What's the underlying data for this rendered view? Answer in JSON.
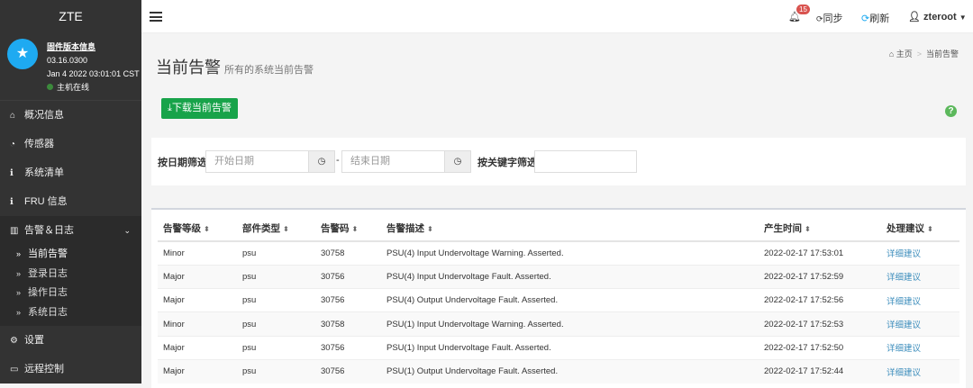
{
  "sidebar": {
    "brand": "ZTE",
    "firmware_title": "固件版本信息",
    "version": "03.16.0300",
    "build_date": "Jan 4 2022 03:01:01 CST",
    "host_status": "主机在线",
    "items": [
      {
        "label": "概况信息",
        "icon": "home-icon"
      },
      {
        "label": "传感器",
        "icon": "dashboard-icon"
      },
      {
        "label": "系统清单",
        "icon": "info-icon"
      },
      {
        "label": "FRU 信息",
        "icon": "info-icon"
      },
      {
        "label": "告警＆日志",
        "icon": "chart-icon"
      }
    ],
    "sub_items": [
      {
        "label": "当前告警"
      },
      {
        "label": "登录日志"
      },
      {
        "label": "操作日志"
      },
      {
        "label": "系统日志"
      }
    ],
    "bottom_items": [
      {
        "label": "设置",
        "icon": "gear-icon"
      },
      {
        "label": "远程控制",
        "icon": "monitor-icon"
      }
    ]
  },
  "topbar": {
    "notification_count": "15",
    "sync": "同步",
    "refresh": "刷新",
    "user": "zteroot"
  },
  "page": {
    "title": "当前告警",
    "subtitle": "所有的系统当前告警",
    "breadcrumb_home": "主页",
    "breadcrumb_current": "当前告警",
    "download_button": "下载当前告警"
  },
  "filter": {
    "date_label": "按日期筛选",
    "start_placeholder": "开始日期",
    "dash": "-",
    "end_placeholder": "结束日期",
    "keyword_label": "按关键字筛选"
  },
  "table": {
    "headers": [
      "告警等级",
      "部件类型",
      "告警码",
      "告警描述",
      "产生时间",
      "处理建议"
    ],
    "rows": [
      [
        "Minor",
        "psu",
        "30758",
        "PSU(4) Input Undervoltage Warning. Asserted.",
        "2022-02-17 17:53:01",
        "详细建议"
      ],
      [
        "Major",
        "psu",
        "30756",
        "PSU(4) Input Undervoltage Fault. Asserted.",
        "2022-02-17 17:52:59",
        "详细建议"
      ],
      [
        "Major",
        "psu",
        "30756",
        "PSU(4) Output Undervoltage Fault. Asserted.",
        "2022-02-17 17:52:56",
        "详细建议"
      ],
      [
        "Minor",
        "psu",
        "30758",
        "PSU(1) Input Undervoltage Warning. Asserted.",
        "2022-02-17 17:52:53",
        "详细建议"
      ],
      [
        "Major",
        "psu",
        "30756",
        "PSU(1) Input Undervoltage Fault. Asserted.",
        "2022-02-17 17:52:50",
        "详细建议"
      ],
      [
        "Major",
        "psu",
        "30756",
        "PSU(1) Output Undervoltage Fault. Asserted.",
        "2022-02-17 17:52:44",
        "详细建议"
      ]
    ]
  }
}
